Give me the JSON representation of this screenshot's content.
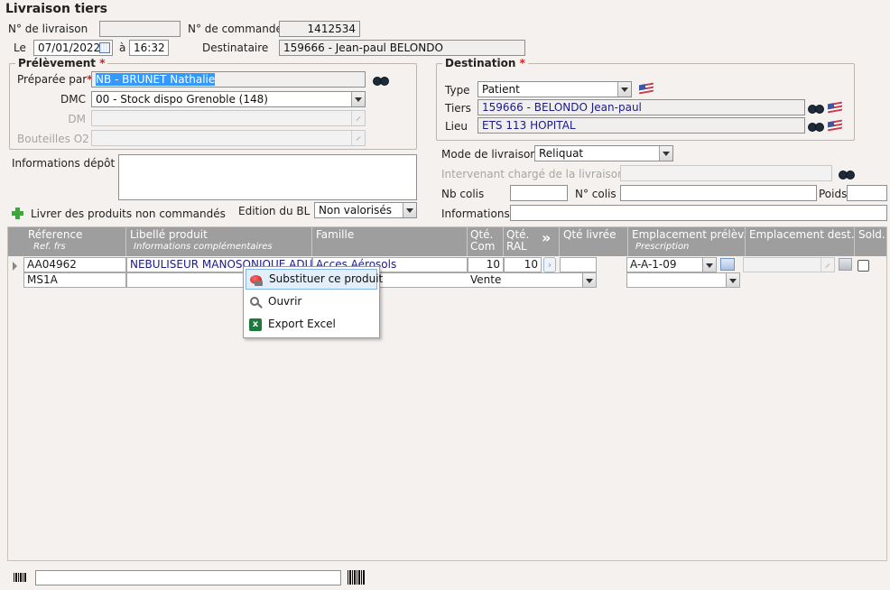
{
  "window": {
    "title": "Livraison tiers"
  },
  "header": {
    "livraison_label": "N° de livraison",
    "livraison_value": "",
    "commande_label": "N° de commande",
    "commande_value": "1412534",
    "le_label": "Le",
    "date_value": "07/01/2022",
    "a_label": "à",
    "time_value": "16:32",
    "destinataire_label": "Destinataire",
    "destinataire_value": "159666 - Jean-paul BELONDO"
  },
  "prelevement": {
    "title": "Prélèvement",
    "required_mark": "*",
    "preparee_label": "Préparée par",
    "preparee_value": "NB - BRUNET Nathalie",
    "dmc_label": "DMC",
    "dmc_value": "00 - Stock dispo Grenoble (148)",
    "dm_label": "DM",
    "dm_value": "",
    "bouteilles_label": "Bouteilles O2",
    "bouteilles_value": ""
  },
  "destination": {
    "title": "Destination",
    "required_mark": "*",
    "type_label": "Type",
    "type_value": "Patient",
    "tiers_label": "Tiers",
    "tiers_value": "159666 - BELONDO Jean-paul",
    "lieu_label": "Lieu",
    "lieu_value": "ETS 113 HOPITAL"
  },
  "livraison": {
    "mode_label": "Mode de livraison",
    "mode_value": "Reliquat",
    "intervenant_label": "Intervenant chargé de la livraison",
    "intervenant_value": "",
    "nbcolis_label": "Nb colis",
    "ncolis_label": "N° colis",
    "poids_label": "Poids",
    "informations_label": "Informations"
  },
  "depot": {
    "label": "Informations dépôt",
    "value": ""
  },
  "actions": {
    "livrer_label": "Livrer des produits non commandés",
    "edition_label": "Edition du BL",
    "edition_value": "Non valorisés"
  },
  "grid": {
    "columns": {
      "reference": "Réference",
      "ref_frs": "Ref. frs",
      "libelle": "Libellé produit",
      "infos": "Informations complémentaires",
      "famille": "Famille",
      "qte_com": [
        "Qté.",
        "Com"
      ],
      "qte_ral": [
        "Qté.",
        "RAL"
      ],
      "qte_livree": "Qté livrée",
      "empl_prelev": "Emplacement prélèv.",
      "prescription": "Prescription",
      "empl_dest": "Emplacement dest.",
      "sold": "Sold."
    },
    "rows": [
      {
        "reference": "AA04962",
        "ref_frs": "MS1A",
        "libelle": "NEBULISEUR MANOSONIQUE ADULTE",
        "famille": "Acces Aérosols",
        "famille2": "Vente",
        "qte_com": "10",
        "qte_ral": "10",
        "qte_livree": "",
        "empl_prelev": "A-A-1-09",
        "empl_dest": ""
      }
    ]
  },
  "context_menu": {
    "items": [
      {
        "label": "Substituer ce produit",
        "icon": "substitute-icon",
        "highlighted": true
      },
      {
        "label": "Ouvrir",
        "icon": "open-icon"
      },
      {
        "label": "Export Excel",
        "icon": "excel-icon"
      }
    ]
  },
  "footer": {
    "barcode_value": ""
  },
  "colors": {
    "grid_header": "#9e9e9e",
    "link_blue": "#1b1b8a",
    "required": "#d42020",
    "selection": "#3399ff"
  }
}
